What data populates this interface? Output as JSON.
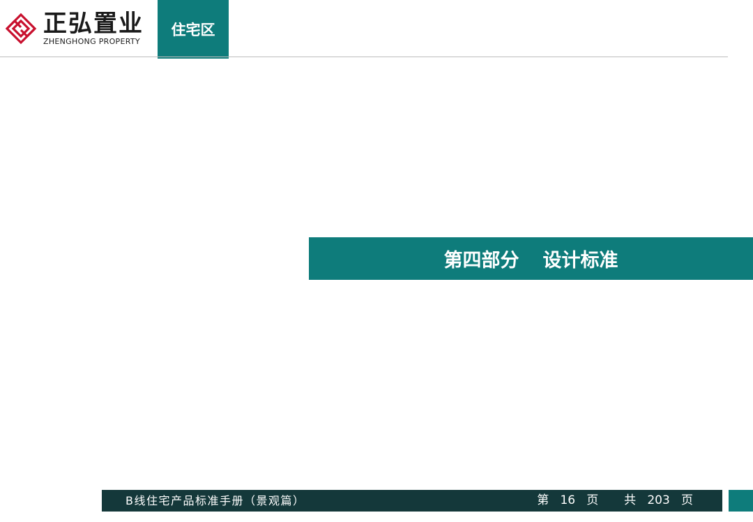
{
  "brand": {
    "logo_icon": "zhenghong-diamond-logo",
    "name_cn": "正弘置业",
    "name_en": "ZHENGHONG PROPERTY",
    "logo_color": "#c8102e"
  },
  "header": {
    "section_tab": "住宅区"
  },
  "main": {
    "title_part": "第四部分",
    "title_name": "设计标准"
  },
  "footer": {
    "manual_title": "B线住宅产品标准手册（景观篇）",
    "page_prefix": "第",
    "page_current": "16",
    "page_suffix": "页",
    "total_prefix": "共",
    "page_total": "203",
    "total_suffix": "页"
  },
  "colors": {
    "teal": "#0e7c7b",
    "footer_dark": "#14383a",
    "white": "#ffffff"
  }
}
